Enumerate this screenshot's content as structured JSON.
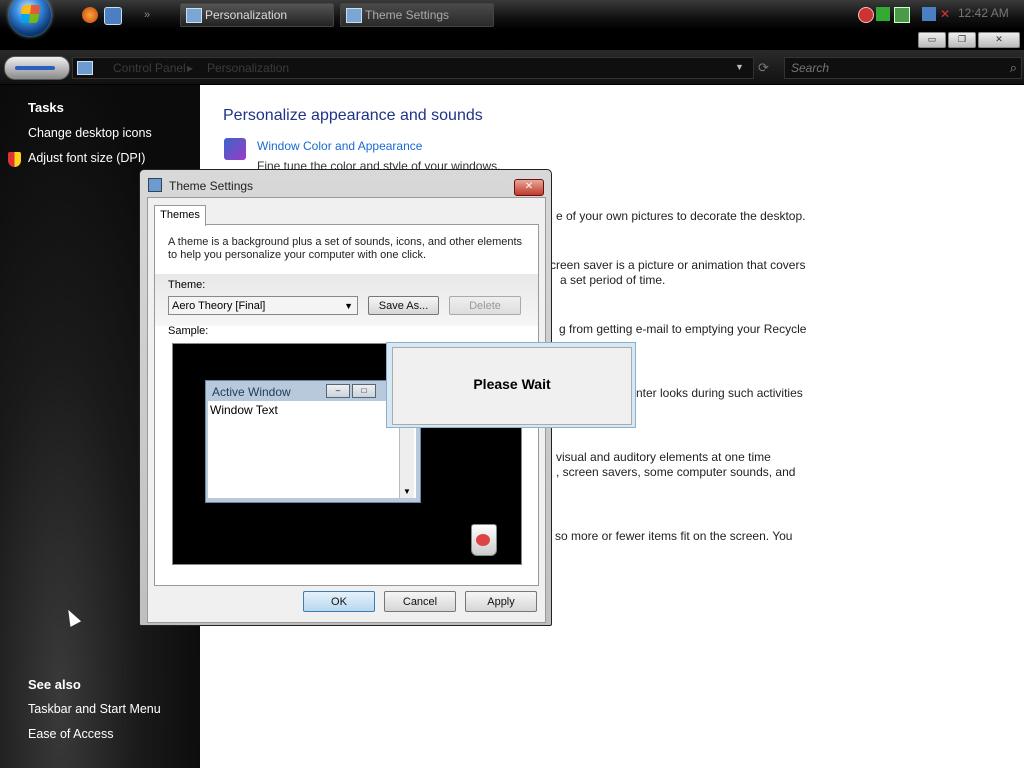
{
  "taskbar": {
    "tasks": [
      {
        "label": "Personalization"
      },
      {
        "label": "Theme Settings"
      }
    ],
    "clock": "12:42 AM"
  },
  "explorer": {
    "breadcrumb": [
      "Control Panel",
      "Personalization"
    ],
    "search_placeholder": "Search",
    "title_controls": {
      "minimize": "▭",
      "maximize": "❐",
      "close": "✕"
    }
  },
  "left_pane": {
    "tasks_heading": "Tasks",
    "tasks": [
      "Change desktop icons",
      "Adjust font size (DPI)"
    ],
    "see_also_heading": "See also",
    "see_also": [
      "Taskbar and Start Menu",
      "Ease of Access"
    ]
  },
  "main": {
    "heading": "Personalize appearance and sounds",
    "window_color_link": "Window Color and Appearance",
    "window_color_desc": "Fine tune the color and style of your windows.",
    "fragments": [
      "e of your own pictures to decorate the desktop.",
      "creen saver is a picture or animation that covers",
      "a set period of time.",
      "g from getting e-mail to emptying your Recycle",
      "nter looks during such activities",
      "visual and auditory elements at one time",
      ", screen savers, some computer sounds, and",
      "so more or fewer items fit on the screen. You"
    ]
  },
  "dialog": {
    "title": "Theme Settings",
    "close_glyph": "✕",
    "tab": "Themes",
    "intro": "A theme is a background plus a set of sounds, icons, and other elements to help you personalize your computer with one click.",
    "theme_label": "Theme:",
    "theme_value": "Aero Theory [Final]",
    "save_as": "Save As...",
    "delete": "Delete",
    "sample_label": "Sample:",
    "sample": {
      "window_title": "Active Window",
      "window_text": "Window Text"
    },
    "ok": "OK",
    "cancel": "Cancel",
    "apply": "Apply"
  },
  "please_wait": "Please Wait"
}
